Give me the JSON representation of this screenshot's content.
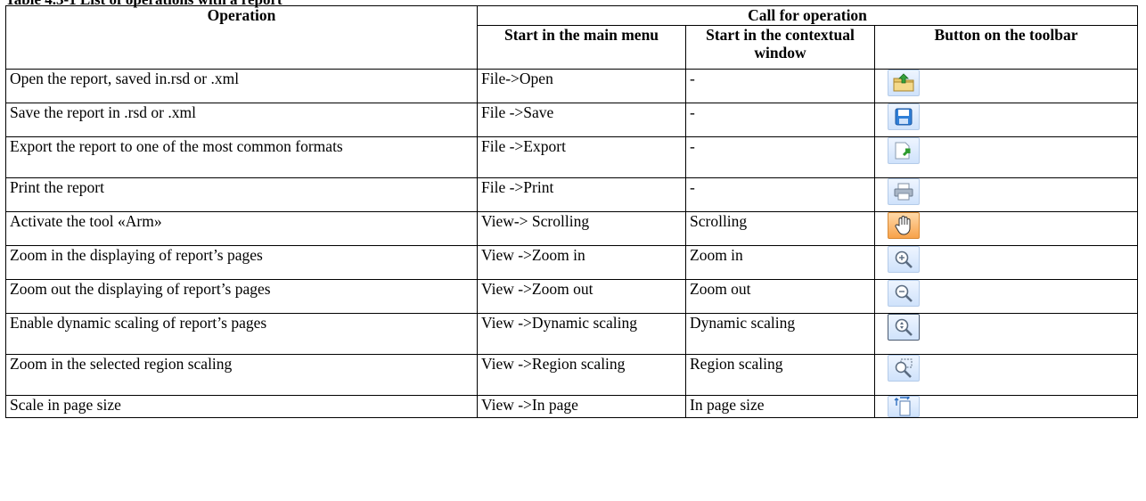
{
  "caption": "Table 4.3-1 List of operations with a report",
  "headers": {
    "operation": "Operation",
    "call_for_operation": "Call for operation",
    "main_menu": "Start in the main menu",
    "contextual": "Start in the contextual window",
    "toolbar": "Button on the toolbar"
  },
  "rows": [
    {
      "operation": "Open the report, saved in.rsd or .xml",
      "menu": "File->Open",
      "context": "-",
      "icon": "open-folder-icon"
    },
    {
      "operation": "Save the report in  .rsd or .xml",
      "menu": "File ->Save",
      "context": "-",
      "icon": "save-disk-icon"
    },
    {
      "operation": "Export the report to one of the most common formats",
      "menu": "File ->Export",
      "context": "-",
      "icon": "export-icon"
    },
    {
      "operation": "Print the report",
      "menu": "File ->Print",
      "context": "-",
      "icon": "printer-icon"
    },
    {
      "operation": "Activate the tool «Arm»",
      "menu": "View-> Scrolling",
      "context": "Scrolling",
      "icon": "hand-icon"
    },
    {
      "operation": "Zoom in the displaying of report’s pages",
      "menu": "View ->Zoom in",
      "context": "Zoom in",
      "icon": "zoom-in-icon"
    },
    {
      "operation": "Zoom out the displaying of report’s pages",
      "menu": "View ->Zoom out",
      "context": "Zoom out",
      "icon": "zoom-out-icon"
    },
    {
      "operation": "Enable dynamic scaling of report’s pages",
      "menu": "View ->Dynamic scaling",
      "context": "Dynamic scaling",
      "icon": "dynamic-zoom-icon"
    },
    {
      "operation": "Zoom in the selected  region scaling",
      "menu": "View ->Region scaling",
      "context": "Region scaling",
      "icon": "region-zoom-icon"
    },
    {
      "operation": "Scale in  page size",
      "menu": "View ->In page",
      "context": "In page size",
      "icon": "fit-page-icon"
    }
  ]
}
